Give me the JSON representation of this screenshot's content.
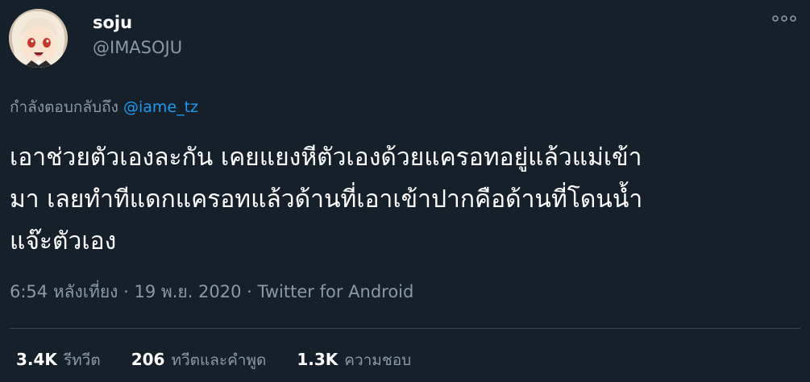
{
  "author": {
    "display_name": "soju",
    "handle": "@IMASOJU",
    "avatar": "anime-girl-avatar"
  },
  "header": {
    "more_icon": "more-horizontal-icon"
  },
  "reply": {
    "prefix": "กำลังตอบกลับถึง",
    "mention": "@iame_tz"
  },
  "tweet": {
    "lines": [
      "เอาช่วยตัวเองละกัน เคยแยงหีตัวเองด้วยแครอทอยู่แล้วแม่เข้า",
      "มา เลยทำทีแดกแครอทแล้วด้านที่เอาเข้าปากคือด้านที่โดนน้ำ",
      "แจ๊ะตัวเอง"
    ]
  },
  "meta": {
    "time": "6:54 หลังเที่ยง",
    "separator": "·",
    "date": "19 พ.ย. 2020",
    "source": "Twitter for Android"
  },
  "stats": {
    "retweets_count": "3.4K",
    "retweets_label": "รีทวีต",
    "quotes_count": "206",
    "quotes_label": "ทวีตและคำพูด",
    "likes_count": "1.3K",
    "likes_label": "ความชอบ"
  },
  "colors": {
    "background": "#15202b",
    "text_primary": "#ffffff",
    "text_secondary": "#8b98a5",
    "link": "#1d9bf0",
    "divider": "#38444d"
  }
}
